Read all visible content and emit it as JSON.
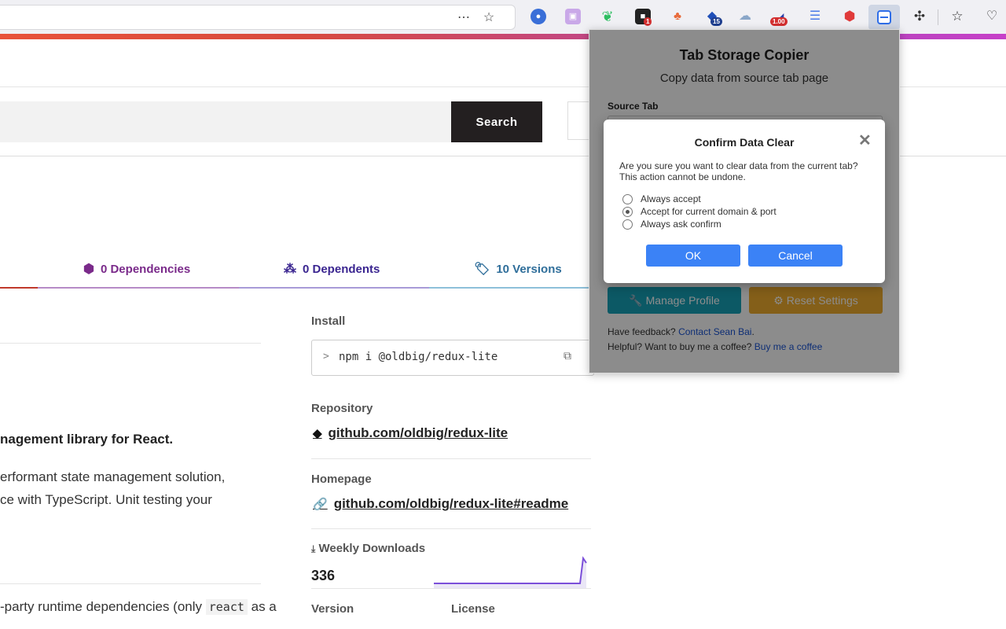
{
  "toolbar": {
    "extensions": [
      {
        "name": "ext-blue-circle-icon",
        "color": "#3a6fd8",
        "badge": ""
      },
      {
        "name": "ext-image-icon",
        "color": "#c9a8e8",
        "badge": ""
      },
      {
        "name": "evernote-icon",
        "color": "#2dbe60",
        "badge": ""
      },
      {
        "name": "ext-black-app-icon",
        "color": "#222222",
        "badge": "1"
      },
      {
        "name": "ext-tree-icon",
        "color": "#e86a3a",
        "badge": ""
      },
      {
        "name": "ext-blue-shapes-icon",
        "color": "#1f4fb8",
        "badge": "15"
      },
      {
        "name": "ext-cloud-icon",
        "color": "#8aa6c8",
        "badge": ""
      },
      {
        "name": "ext-speed-icon",
        "color": "#2a3fa8",
        "badge": "1.00"
      },
      {
        "name": "ext-lines-icon",
        "color": "#4a7ae8",
        "badge": ""
      },
      {
        "name": "ext-dice-icon",
        "color": "#e03a3a",
        "badge": ""
      }
    ]
  },
  "search": {
    "button_label": "Search"
  },
  "tabs": {
    "dependencies": "0 Dependencies",
    "dependents": "0 Dependents",
    "versions": "10 Versions"
  },
  "colors": {
    "dependencies": "#7a2a8a",
    "dependents": "#3a2590",
    "versions": "#2f6e9a"
  },
  "sidebar": {
    "install_label": "Install",
    "install_cmd": "npm i @oldbig/redux-lite",
    "repository_label": "Repository",
    "repository_link": "github.com/oldbig/redux-lite",
    "homepage_label": "Homepage",
    "homepage_link": "github.com/oldbig/redux-lite#readme",
    "weekly_downloads_label": "Weekly Downloads",
    "weekly_downloads": "336",
    "version_label": "Version",
    "license_label": "License"
  },
  "readme": {
    "heading": "nagement library for React.",
    "line1": "erformant state management solution,",
    "line2": "ce with TypeScript. Unit testing your",
    "deps_pre": "-party runtime dependencies (only ",
    "deps_code": "react",
    "deps_post": " as a"
  },
  "popup": {
    "title": "Tab Storage Copier",
    "subtitle": "Copy data from source tab page",
    "source_label": "Source Tab",
    "manage_profile": "Manage Profile",
    "reset_settings": "Reset Settings",
    "feedback_text": "Have feedback? ",
    "feedback_link": "Contact Sean Bai",
    "feedback_dot": ".",
    "coffee_text": "Helpful? Want to buy me a coffee? ",
    "coffee_link": "Buy me a coffee"
  },
  "modal": {
    "title": "Confirm Data Clear",
    "message_line1": "Are you sure you want to clear data from the current tab?",
    "message_line2": "This action cannot be undone.",
    "options": [
      "Always accept",
      "Accept for current domain & port",
      "Always ask confirm"
    ],
    "ok": "OK",
    "cancel": "Cancel"
  }
}
